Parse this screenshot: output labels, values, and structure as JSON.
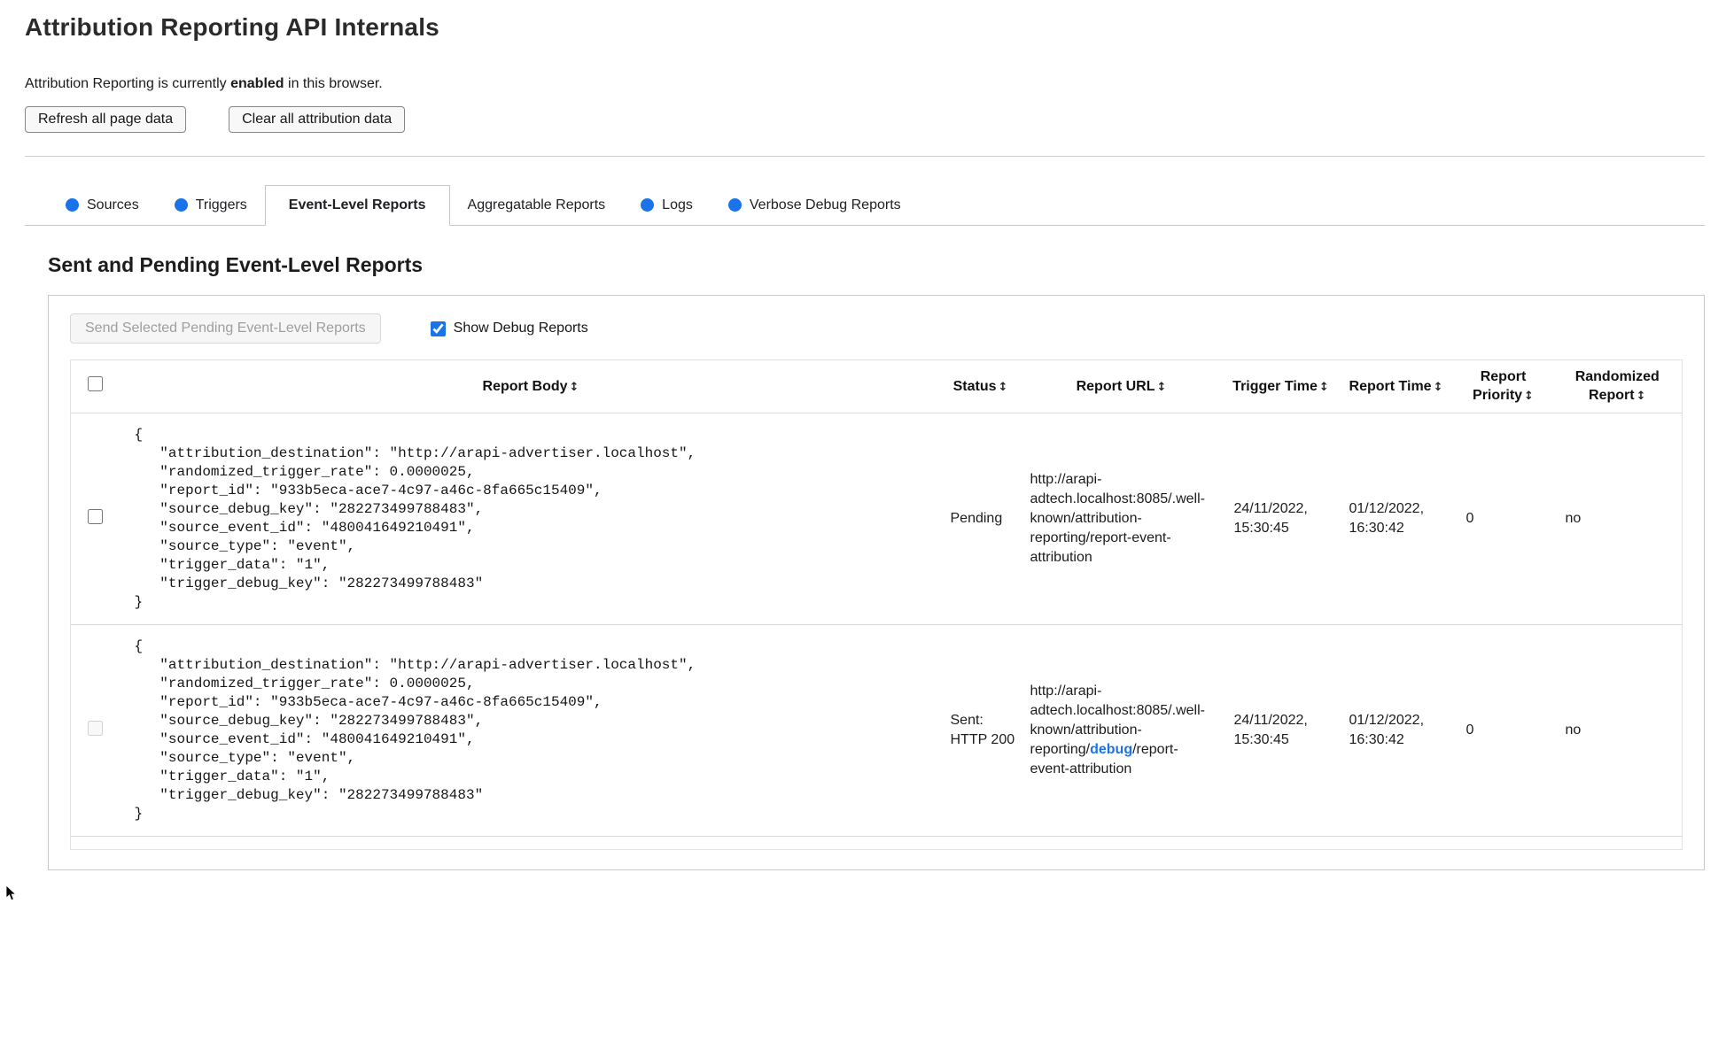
{
  "header": {
    "title": "Attribution Reporting API Internals",
    "status_prefix": "Attribution Reporting is currently",
    "status_emphasis": "enabled",
    "status_suffix": "in this browser.",
    "refresh_button": "Refresh all page data",
    "clear_button": "Clear all attribution data"
  },
  "tabs": [
    {
      "label": "Sources",
      "dot": true,
      "active": false
    },
    {
      "label": "Triggers",
      "dot": true,
      "active": false
    },
    {
      "label": "Event-Level Reports",
      "dot": false,
      "active": true
    },
    {
      "label": "Aggregatable Reports",
      "dot": false,
      "active": false
    },
    {
      "label": "Logs",
      "dot": true,
      "active": false
    },
    {
      "label": "Verbose Debug Reports",
      "dot": true,
      "active": false
    }
  ],
  "panel": {
    "heading": "Sent and Pending Event-Level Reports",
    "send_button": "Send Selected Pending Event-Level Reports",
    "send_button_disabled": true,
    "show_debug_label": "Show Debug Reports",
    "show_debug_checked": true
  },
  "table": {
    "sort_icon": "↕",
    "select_all_checked": false,
    "headers": [
      "Report Body",
      "Status",
      "Report URL",
      "Trigger Time",
      "Report Time",
      "Report Priority",
      "Randomized Report"
    ],
    "rows": [
      {
        "selected": false,
        "checkbox_disabled": false,
        "report_body": "{\n   \"attribution_destination\": \"http://arapi-advertiser.localhost\",\n   \"randomized_trigger_rate\": 0.0000025,\n   \"report_id\": \"933b5eca-ace7-4c97-a46c-8fa665c15409\",\n   \"source_debug_key\": \"282273499788483\",\n   \"source_event_id\": \"480041649210491\",\n   \"source_type\": \"event\",\n   \"trigger_data\": \"1\",\n   \"trigger_debug_key\": \"282273499788483\"\n}",
        "status": "Pending",
        "report_url": "http://arapi-adtech.localhost:8085/.well-known/attribution-reporting/report-event-attribution",
        "trigger_time": "24/11/2022, 15:30:45",
        "report_time": "01/12/2022, 16:30:42",
        "report_priority": "0",
        "randomized_report": "no"
      },
      {
        "selected": false,
        "checkbox_disabled": true,
        "report_body": "{\n   \"attribution_destination\": \"http://arapi-advertiser.localhost\",\n   \"randomized_trigger_rate\": 0.0000025,\n   \"report_id\": \"933b5eca-ace7-4c97-a46c-8fa665c15409\",\n   \"source_debug_key\": \"282273499788483\",\n   \"source_event_id\": \"480041649210491\",\n   \"source_type\": \"event\",\n   \"trigger_data\": \"1\",\n   \"trigger_debug_key\": \"282273499788483\"\n}",
        "status": "Sent: HTTP 200",
        "report_url_prefix": "http://arapi-adtech.localhost:8085/.well-known/attribution-reporting/",
        "report_url_highlight": "debug",
        "report_url_suffix": "/report-event-attribution",
        "trigger_time": "24/11/2022, 15:30:45",
        "report_time": "01/12/2022, 16:30:42",
        "report_priority": "0",
        "randomized_report": "no"
      }
    ]
  },
  "colors": {
    "accent_blue": "#1a73e8",
    "debug_highlight": "#1a73e8"
  }
}
